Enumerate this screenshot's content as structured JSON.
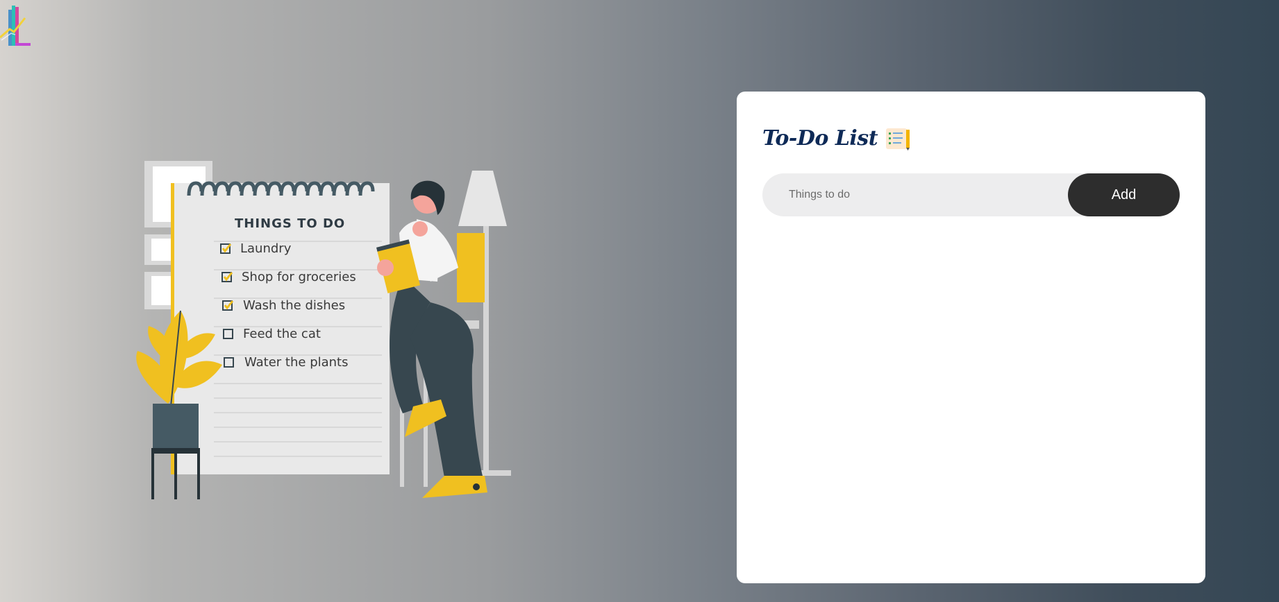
{
  "app": {
    "title": "To-Do List",
    "title_icon": "checklist-with-pencil-icon",
    "logo_icon": "IL-logo-icon"
  },
  "todo": {
    "input_placeholder": "Things to do",
    "input_value": "",
    "add_label": "Add",
    "tasks": []
  },
  "illustration": {
    "notebook_heading": "THINGS TO DO",
    "items": [
      {
        "label": "Laundry",
        "checked": true
      },
      {
        "label": "Shop for groceries",
        "checked": true
      },
      {
        "label": "Wash the dishes",
        "checked": true
      },
      {
        "label": "Feed the cat",
        "checked": false
      },
      {
        "label": "Water the plants",
        "checked": false
      }
    ]
  },
  "colors": {
    "title": "#0e2a57",
    "add_button": "#2d2d2d",
    "input_bg": "#ededee",
    "accent_yellow": "#f0c020",
    "dark_slate": "#37474f"
  }
}
